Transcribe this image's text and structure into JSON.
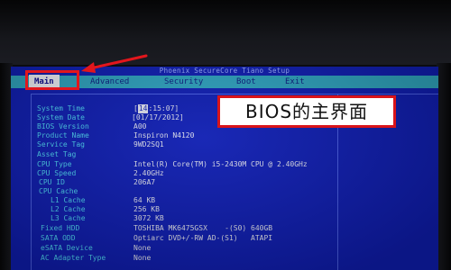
{
  "bios": {
    "title": "Phoenix SecureCore Tiano Setup",
    "tabs": [
      {
        "label": "Main",
        "active": true
      },
      {
        "label": "Advanced",
        "active": false
      },
      {
        "label": "Security",
        "active": false
      },
      {
        "label": "Boot",
        "active": false
      },
      {
        "label": "Exit",
        "active": false
      }
    ],
    "fields": [
      {
        "label": "System Time",
        "value": "15:07",
        "cursor_part": "14"
      },
      {
        "label": "System Date",
        "value": "[01/17/2012]"
      },
      {
        "label": "BIOS Version",
        "value": "A00"
      },
      {
        "label": "Product Name",
        "value": "Inspiron N4120"
      },
      {
        "label": "Service Tag",
        "value": "9WD2SQ1"
      },
      {
        "label": "Asset Tag",
        "value": ""
      },
      {
        "label": "CPU Type",
        "value": "Intel(R) Core(TM) i5-2430M CPU @ 2.40GHz"
      },
      {
        "label": "CPU Speed",
        "value": "2.40GHz"
      },
      {
        "label": "CPU ID",
        "value": "206A7"
      },
      {
        "label": "CPU Cache",
        "value": ""
      },
      {
        "label": "L1 Cache",
        "value": "64 KB"
      },
      {
        "label": "L2 Cache",
        "value": "256 KB"
      },
      {
        "label": "L3 Cache",
        "value": "3072 KB"
      },
      {
        "label": "Fixed HDD",
        "value": "TOSHIBA MK6475GSX    -(S0) 640GB"
      },
      {
        "label": "SATA ODD",
        "value": "Optiarc DVD+/-RW AD-(S1)   ATAPI"
      },
      {
        "label": "eSATA Device",
        "value": "None"
      },
      {
        "label": "AC Adapter Type",
        "value": "None"
      }
    ]
  },
  "annotation": {
    "caption": "BIOS的主界面",
    "highlight_color": "#e2161c"
  }
}
